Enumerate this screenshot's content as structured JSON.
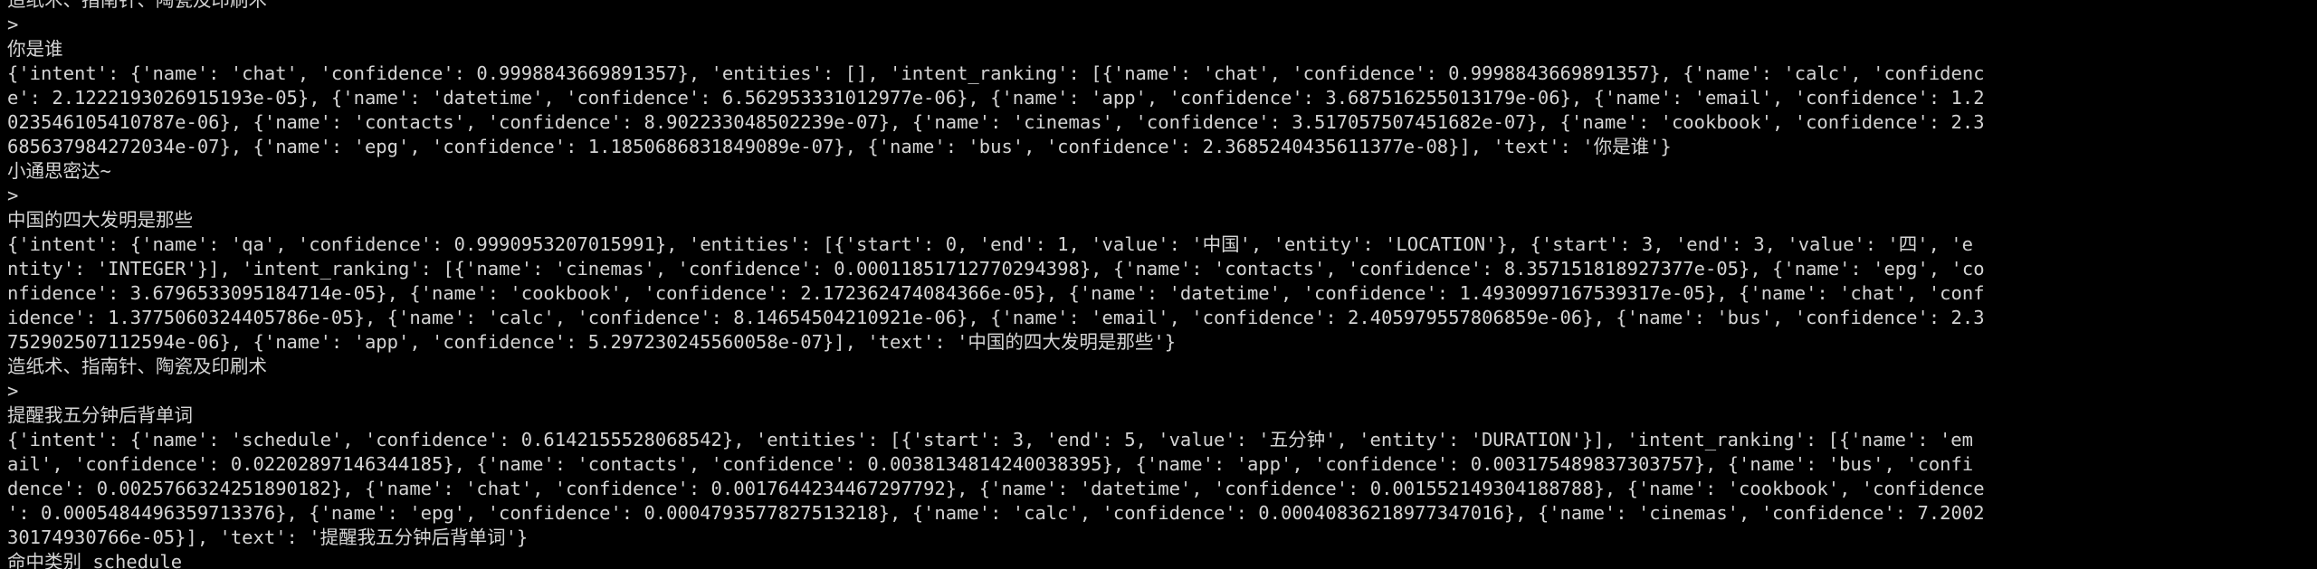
{
  "terminal": {
    "lines": [
      "造纸术、指南针、陶瓷及印刷术",
      ">",
      "你是谁",
      "{'intent': {'name': 'chat', 'confidence': 0.9998843669891357}, 'entities': [], 'intent_ranking': [{'name': 'chat', 'confidence': 0.9998843669891357}, {'name': 'calc', 'confidenc",
      "e': 2.1222193026915193e-05}, {'name': 'datetime', 'confidence': 6.562953331012977e-06}, {'name': 'app', 'confidence': 3.687516255013179e-06}, {'name': 'email', 'confidence': 1.2",
      "023546105410787e-06}, {'name': 'contacts', 'confidence': 8.902233048502239e-07}, {'name': 'cinemas', 'confidence': 3.517057507451682e-07}, {'name': 'cookbook', 'confidence': 2.3",
      "685637984272034e-07}, {'name': 'epg', 'confidence': 1.1850686831849089e-07}, {'name': 'bus', 'confidence': 2.3685240435611377e-08}], 'text': '你是谁'}",
      "小通思密达~",
      ">",
      "中国的四大发明是那些",
      "{'intent': {'name': 'qa', 'confidence': 0.9990953207015991}, 'entities': [{'start': 0, 'end': 1, 'value': '中国', 'entity': 'LOCATION'}, {'start': 3, 'end': 3, 'value': '四', 'e",
      "ntity': 'INTEGER'}], 'intent_ranking': [{'name': 'cinemas', 'confidence': 0.00011851712770294398}, {'name': 'contacts', 'confidence': 8.357151818927377e-05}, {'name': 'epg', 'co",
      "nfidence': 3.6796533095184714e-05}, {'name': 'cookbook', 'confidence': 2.172362474084366e-05}, {'name': 'datetime', 'confidence': 1.4930997167539317e-05}, {'name': 'chat', 'conf",
      "idence': 1.3775060324405786e-05}, {'name': 'calc', 'confidence': 8.14654504210921e-06}, {'name': 'email', 'confidence': 2.405979557806859e-06}, {'name': 'bus', 'confidence': 2.3",
      "752902507112594e-06}, {'name': 'app', 'confidence': 5.297230245560058e-07}], 'text': '中国的四大发明是那些'}",
      "造纸术、指南针、陶瓷及印刷术",
      ">",
      "提醒我五分钟后背单词",
      "{'intent': {'name': 'schedule', 'confidence': 0.6142155528068542}, 'entities': [{'start': 3, 'end': 5, 'value': '五分钟', 'entity': 'DURATION'}], 'intent_ranking': [{'name': 'em",
      "ail', 'confidence': 0.02202897146344185}, {'name': 'contacts', 'confidence': 0.0038134814240038395}, {'name': 'app', 'confidence': 0.003175489837303757}, {'name': 'bus', 'confi",
      "dence': 0.0025766324251890182}, {'name': 'chat', 'confidence': 0.0017644234467297792}, {'name': 'datetime', 'confidence': 0.001552149304188788}, {'name': 'cookbook', 'confidence",
      "': 0.0005484496359713376}, {'name': 'epg', 'confidence': 0.0004793577827513218}, {'name': 'calc', 'confidence': 0.00040836218977347016}, {'name': 'cinemas', 'confidence': 7.2002",
      "30174930766e-05}], 'text': '提醒我五分钟后背单词'}",
      "命中类别 schedule"
    ]
  }
}
